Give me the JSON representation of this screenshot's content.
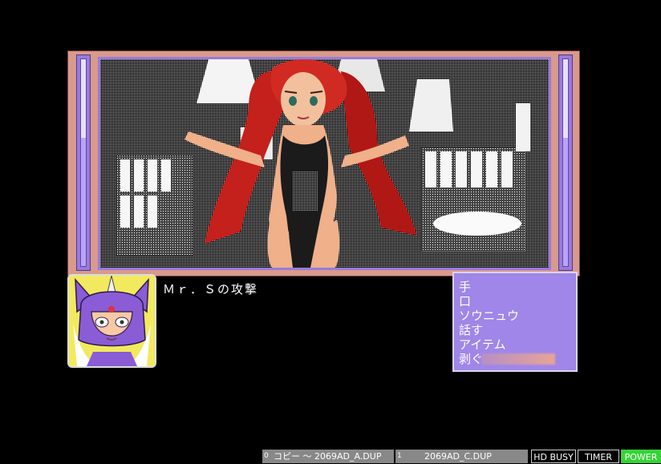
{
  "scene": {
    "icon": "scene-illustration",
    "colors": {
      "frame": "#d89a8c",
      "gauge": "#9a7adc",
      "hair": "#c4201c",
      "skin": "#efb08a"
    }
  },
  "gauges": {
    "left_level": 0.62,
    "right_level": 0.62
  },
  "portrait": {
    "icon": "masked-hero-portrait"
  },
  "message": {
    "text": "Ｍｒ．Ｓの攻撃"
  },
  "menu": {
    "items": [
      "手",
      "口",
      "ソウニュウ",
      "話す",
      "アイテム",
      "剥ぐ"
    ],
    "selected_index": 5
  },
  "statusbar": {
    "drive1_num": "0",
    "drive1_label": "コピー ～ 2069AD_A.DUP",
    "drive2_num": "1",
    "drive2_label": "2069AD_C.DUP",
    "hd_busy": "HD BUSY",
    "timer": "TIMER",
    "power": "POWER",
    "power_color": "#37d437"
  }
}
